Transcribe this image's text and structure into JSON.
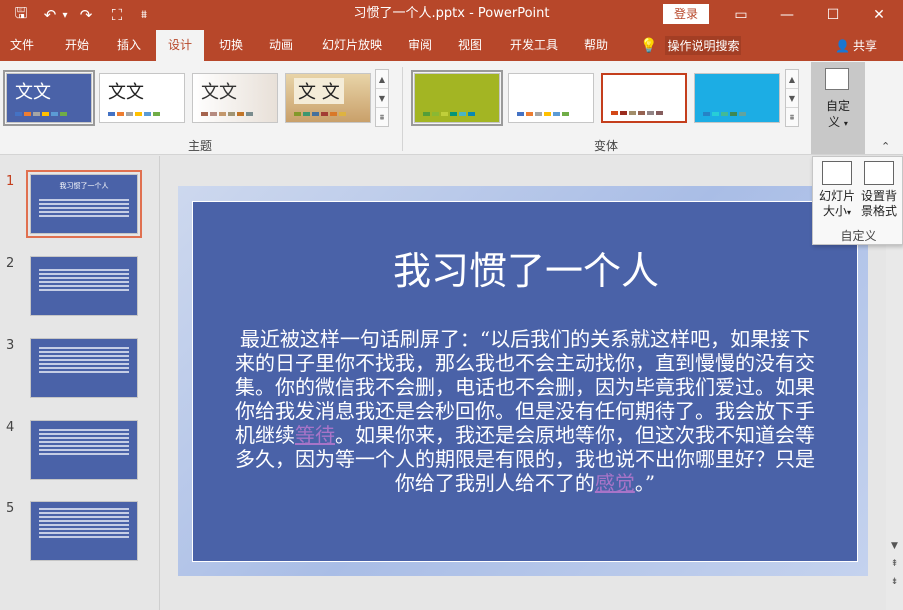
{
  "window": {
    "title": "习惯了一个人.pptx - PowerPoint",
    "login_label": "登录",
    "controls": {
      "ribbon_display": "▭",
      "minimize": "—",
      "maximize": "☐",
      "close": "✕"
    }
  },
  "quick_access": {
    "save": "🖫",
    "undo": "↶",
    "undo_drop": "▾",
    "redo": "↷",
    "presenter": "⛶",
    "customize": "⩩"
  },
  "tabs": [
    "文件",
    "开始",
    "插入",
    "设计",
    "切换",
    "动画",
    "幻灯片放映",
    "审阅",
    "视图",
    "开发工具",
    "帮助"
  ],
  "tell_me": "操作说明搜索",
  "share": "共享",
  "ribbon": {
    "themes_label": "主题",
    "variants_label": "变体",
    "theme_sample_text": "文文",
    "theme_sample_text_3": "文文",
    "theme_sample_text_4": "文 文",
    "customize_label_1": "自定",
    "customize_label_2": "义",
    "caret": "▾",
    "gallery_scroll": [
      "▲",
      "▼",
      "⩩"
    ]
  },
  "customize_dropdown": {
    "slide_size_1": "幻灯片",
    "slide_size_2": "大小",
    "format_bg_1": "设置背",
    "format_bg_2": "景格式",
    "group_label": "自定义"
  },
  "collapse_caret": "⌃",
  "slides": [
    {
      "number": "1",
      "thumb_title": "我习惯了一个人"
    },
    {
      "number": "2"
    },
    {
      "number": "3"
    },
    {
      "number": "4"
    },
    {
      "number": "5"
    }
  ],
  "current_slide": {
    "title": "我习惯了一个人",
    "body_part1": "最近被这样一句话刷屏了：“以后我们的关系就这样吧，如果接下来的日子里你不找我，那么我也不会主动找你，直到慢慢的没有交集。你的微信我不会删，电话也不会删，因为毕竟我们爱过。如果你给我发消息我还是会秒回你。但是没有任何期待了。我会放下手机继续",
    "body_link1": "等待",
    "body_part2": "。如果你来，我还是会原地等你，但这次我不知道会等多久，因为等一个人的期限是有限的，我也说不出你哪里好？只是你给了我别人给不了的",
    "body_link2": "感觉",
    "body_part3": "。”"
  },
  "scrollbar": {
    "up": "▲",
    "down": "▼",
    "prev": "⇞",
    "next": "⇟"
  }
}
